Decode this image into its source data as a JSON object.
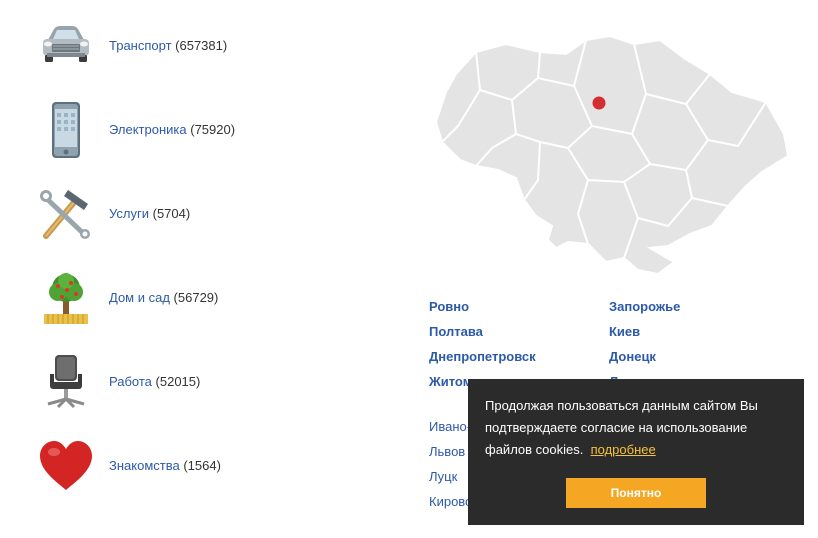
{
  "categories": [
    {
      "icon": "car-icon",
      "label": "Транспорт",
      "count": "(657381)"
    },
    {
      "icon": "smartphone-icon",
      "label": "Электроника",
      "count": "(75920)"
    },
    {
      "icon": "tools-icon",
      "label": "Услуги",
      "count": "(5704)"
    },
    {
      "icon": "tree-icon",
      "label": "Дом и сад",
      "count": "(56729)"
    },
    {
      "icon": "office-chair-icon",
      "label": "Работа",
      "count": "(52015)"
    },
    {
      "icon": "heart-icon",
      "label": "Знакомства",
      "count": "(1564)"
    }
  ],
  "map": {
    "icon": "ukraine-map-icon",
    "marker_color": "#d32f2f",
    "region_color": "#e4e4e4"
  },
  "cities": {
    "left": [
      "Ровно",
      "Полтава",
      "Днепропетровск",
      "Житомир"
    ],
    "right": [
      "Запорожье",
      "Киев",
      "Донецк",
      "Львов"
    ],
    "small_left": [
      "Ивано-Франковск",
      "Львов",
      "Луцк",
      "Кировоград"
    ]
  },
  "cookie": {
    "text": "Продолжая пользоваться данным сайтом Вы подтверждаете согласие на использование файлов cookies.",
    "more_link": "подробнее",
    "accept_button": "Понятно"
  },
  "colors": {
    "link": "#2d5aa8",
    "cookie_bg": "#2b2b2b",
    "button": "#f5a623"
  }
}
